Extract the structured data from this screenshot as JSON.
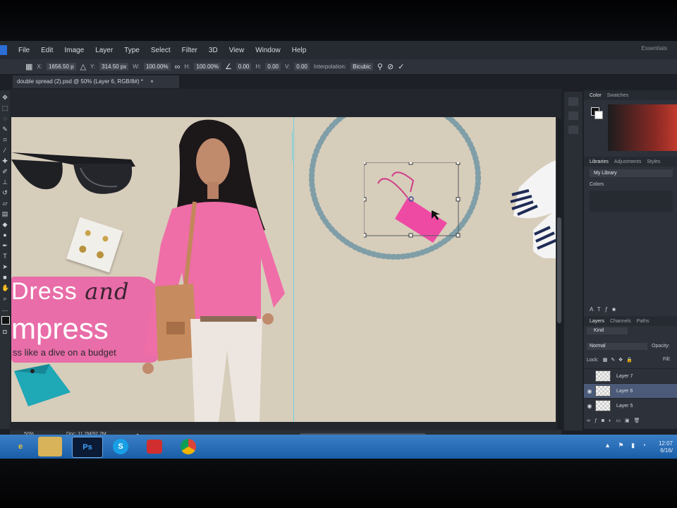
{
  "menu": {
    "items": [
      "File",
      "Edit",
      "Image",
      "Layer",
      "Type",
      "Select",
      "Filter",
      "3D",
      "View",
      "Window",
      "Help"
    ],
    "workspace": "Essentials"
  },
  "options": {
    "x_label": "X:",
    "x_value": "1656.50 p",
    "y_label": "Y:",
    "y_value": "314.50 px",
    "w_label": "W:",
    "w_value": "100.00%",
    "h_label": "H:",
    "h_value": "100.00%",
    "angle_value": "0.00",
    "hskew_label": "H:",
    "hskew_value": "0.00",
    "vskew_label": "V:",
    "vskew_value": "0.00",
    "interp_label": "Interpolation:",
    "interp_value": "Bicubic"
  },
  "document": {
    "tab_title": "double spread (2).psd @ 50% (Layer 6, RGB/8#) *",
    "tab_close": "×"
  },
  "artwork": {
    "headline_1": "Dress",
    "headline_and": "and",
    "headline_2": "mpress",
    "tagline": "ss like a dive on a budget"
  },
  "status": {
    "zoom": "50%",
    "doc_size": "Doc: 11.2M/92.2M"
  },
  "panels": {
    "color_tab": "Color",
    "swatches_tab": "Swatches",
    "libraries_tab": "Libraries",
    "adjustments_tab": "Adjustments",
    "styles_tab": "Styles",
    "library_name": "My Library",
    "colors_label": "Colors",
    "layers_tab": "Layers",
    "channels_tab": "Channels",
    "paths_tab": "Paths",
    "filter_kind": "Kind",
    "blend_mode": "Normal",
    "opacity_label": "Opacity:",
    "lock_label": "Lock:",
    "fill_label": "Fill:",
    "layers": [
      {
        "name": "Layer 7",
        "visible": false,
        "selected": false
      },
      {
        "name": "Layer 6",
        "visible": true,
        "selected": true
      },
      {
        "name": "Layer 5",
        "visible": true,
        "selected": false
      }
    ]
  },
  "taskbar": {
    "apps": [
      "internet-explorer-icon",
      "file-explorer-icon",
      "photoshop-icon",
      "skype-icon",
      "creative-cloud-icon",
      "chrome-icon"
    ],
    "ps_label": "Ps",
    "clock_time": "12:07",
    "clock_date": "6/16/"
  },
  "colors": {
    "accent_pink": "#e86da8",
    "taskbar_blue": "#2a6fb8",
    "selected_layer": "#4a5a78"
  }
}
